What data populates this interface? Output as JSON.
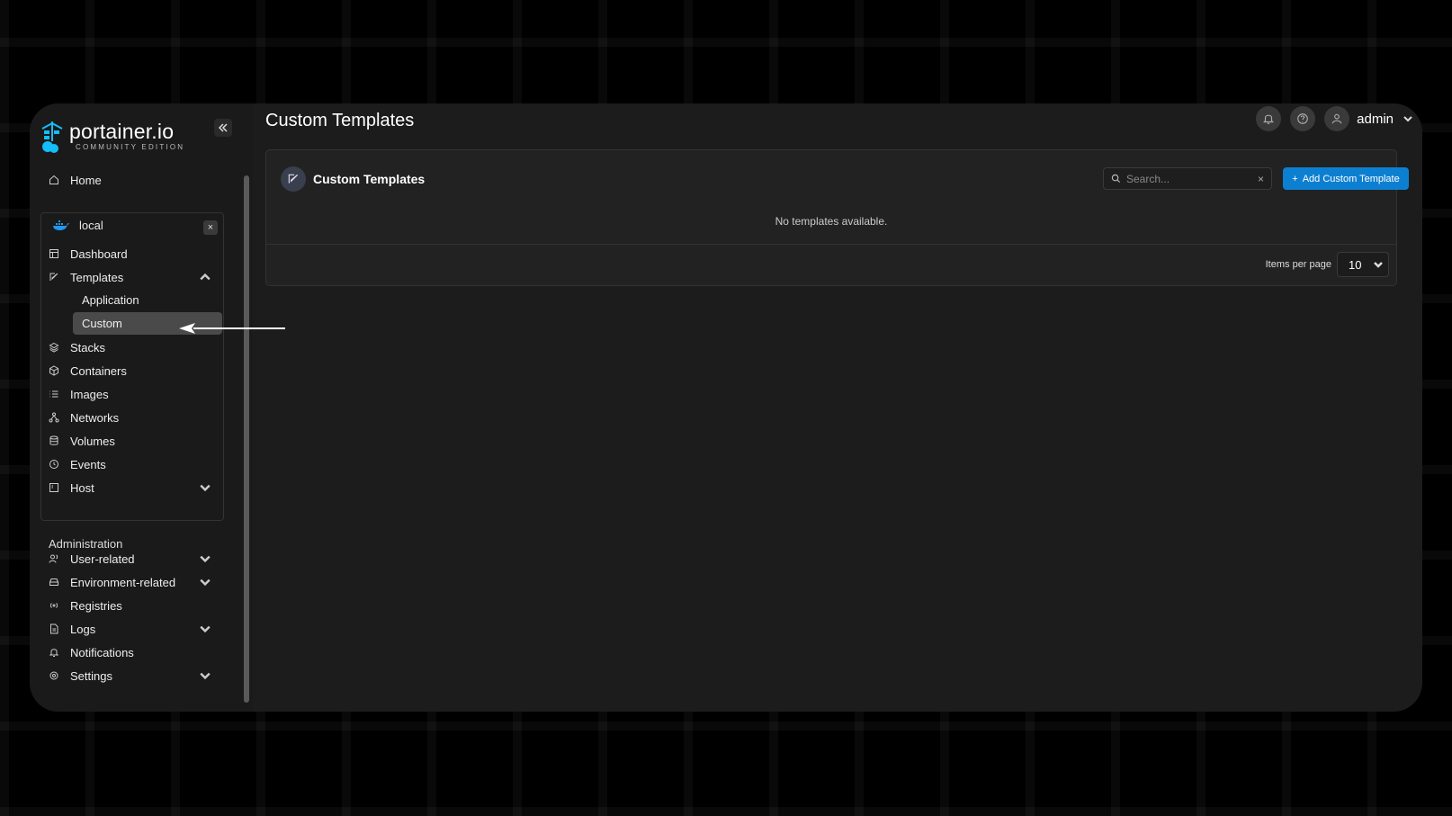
{
  "brand": {
    "name": "portainer.io",
    "edition": "COMMUNITY EDITION"
  },
  "sidebar": {
    "collapse_icon": "double-chevron-left-icon",
    "home": "Home",
    "environment": {
      "name": "local",
      "close": "×"
    },
    "env_items": [
      {
        "label": "Dashboard"
      },
      {
        "label": "Templates"
      },
      {
        "label": "Stacks"
      },
      {
        "label": "Containers"
      },
      {
        "label": "Images"
      },
      {
        "label": "Networks"
      },
      {
        "label": "Volumes"
      },
      {
        "label": "Events"
      },
      {
        "label": "Host"
      }
    ],
    "templates_sub": [
      {
        "label": "Application"
      },
      {
        "label": "Custom",
        "active": true
      }
    ],
    "admin_label": "Administration",
    "admin_items": [
      {
        "label": "User-related"
      },
      {
        "label": "Environment-related"
      },
      {
        "label": "Registries"
      },
      {
        "label": "Logs"
      },
      {
        "label": "Notifications"
      },
      {
        "label": "Settings"
      }
    ]
  },
  "header": {
    "title": "Custom Templates",
    "user": "admin"
  },
  "panel": {
    "title": "Custom Templates",
    "search_placeholder": "Search...",
    "search_clear": "×",
    "add_button": "Add Custom Template",
    "add_icon": "+",
    "empty": "No templates available.",
    "items_per_page_label": "Items per page",
    "items_per_page_value": "10"
  },
  "colors": {
    "accent": "#0d7fd1",
    "background": "#1c1c1c",
    "active_item": "#4a4a4a"
  }
}
